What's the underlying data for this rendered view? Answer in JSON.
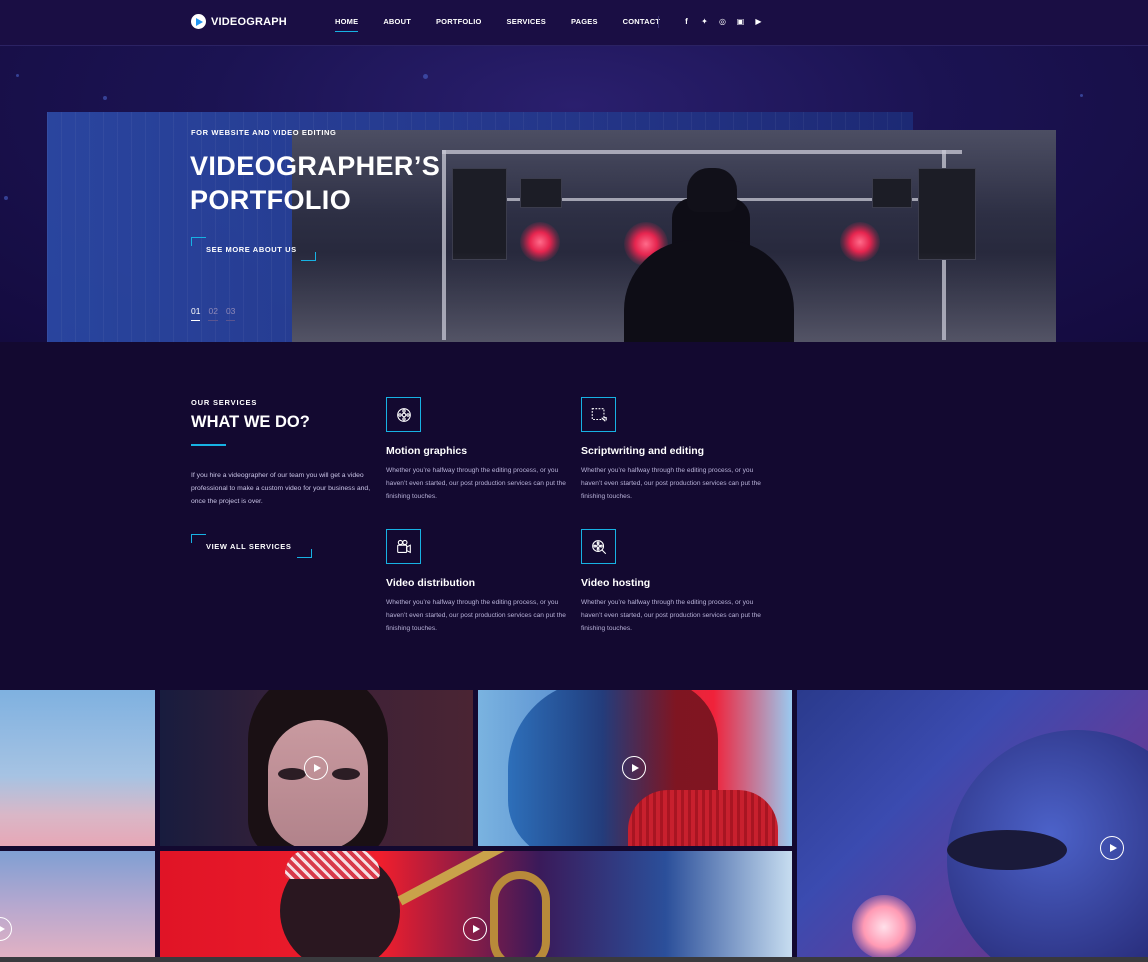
{
  "header": {
    "logo": "VIDEOGRAPH",
    "nav": [
      "HOME",
      "ABOUT",
      "PORTFOLIO",
      "SERVICES",
      "PAGES",
      "CONTACT"
    ],
    "social": [
      {
        "name": "facebook-icon",
        "glyph": "f"
      },
      {
        "name": "twitter-icon",
        "glyph": "✦"
      },
      {
        "name": "dribbble-icon",
        "glyph": "◎"
      },
      {
        "name": "instagram-icon",
        "glyph": "▣"
      },
      {
        "name": "youtube-icon",
        "glyph": "▶"
      }
    ]
  },
  "hero": {
    "kicker": "FOR WEBSITE AND VIDEO EDITING",
    "title_line1": "VIDEOGRAPHER’S",
    "title_line2": "PORTFOLIO",
    "cta": "SEE MORE ABOUT US",
    "slides": [
      "01",
      "02",
      "03"
    ]
  },
  "services": {
    "kicker": "OUR SERVICES",
    "title": "WHAT WE DO?",
    "description": "If you hire a videographer of our team you will get a video professional to make a custom video for your business and, once the project is over.",
    "cta": "VIEW ALL SERVICES",
    "items": [
      {
        "name": "Motion graphics",
        "icon": "film-reel-icon",
        "text": "Whether you’re halfway through the editing process, or you haven’t even started, our post production services can put the finishing touches."
      },
      {
        "name": "Scriptwriting and editing",
        "icon": "edit-frame-icon",
        "text": "Whether you’re halfway through the editing process, or you haven’t even started, our post production services can put the finishing touches."
      },
      {
        "name": "Video distribution",
        "icon": "video-camera-icon",
        "text": "Whether you’re halfway through the editing process, or you haven’t even started, our post production services can put the finishing touches."
      },
      {
        "name": "Video hosting",
        "icon": "search-reel-icon",
        "text": "Whether you’re halfway through the editing process, or you haven’t even started, our post production services can put the finishing touches."
      }
    ]
  },
  "colors": {
    "accent": "#17b2e3",
    "background": "#130930",
    "header": "#1a0e44"
  }
}
